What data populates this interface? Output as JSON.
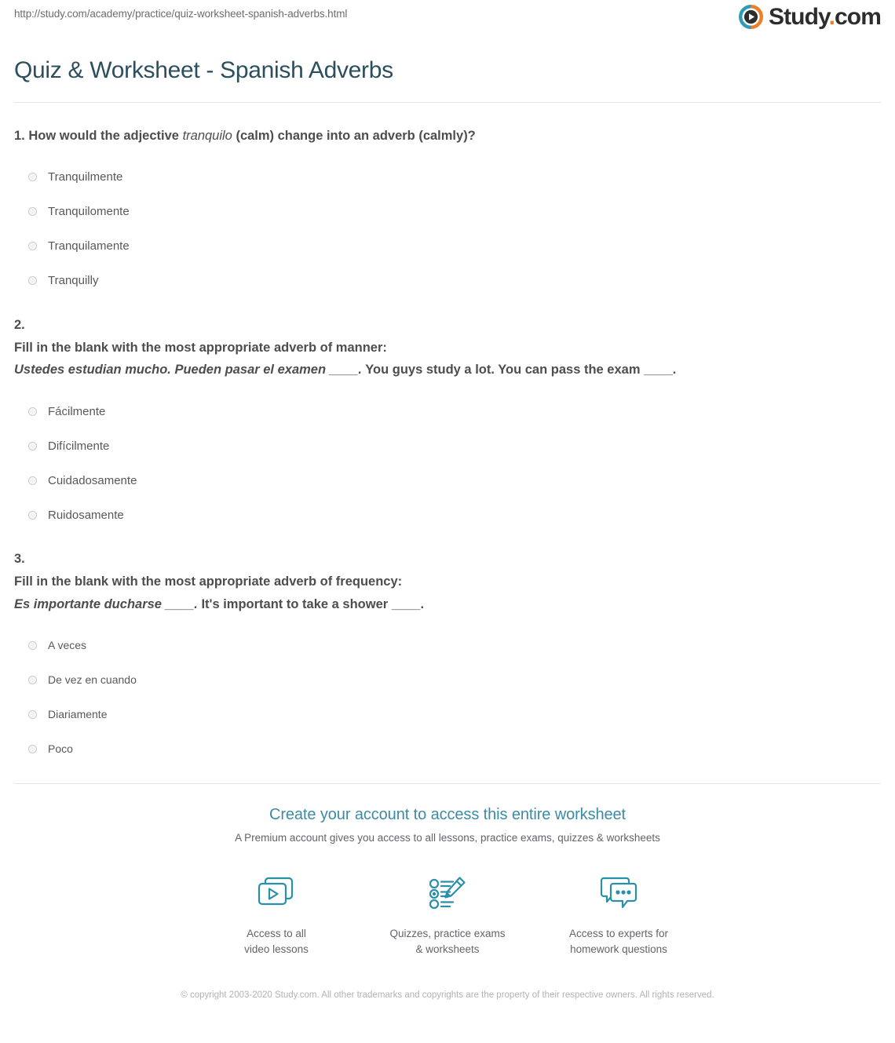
{
  "header": {
    "url": "http://study.com/academy/practice/quiz-worksheet-spanish-adverbs.html",
    "logo_text_main": "Study",
    "logo_text_dot": ".",
    "logo_text_tld": "com",
    "logo_icon": "play-circle-icon",
    "colors": {
      "logo_teal": "#2f9bb5",
      "logo_orange": "#f07e26",
      "title": "#2c4f5e",
      "link": "#3d8ba3",
      "icon_teal": "#2a8fa8"
    }
  },
  "title": "Quiz & Worksheet - Spanish Adverbs",
  "questions": [
    {
      "number": "1.",
      "inline": true,
      "prompt_before": "How would the adjective ",
      "prompt_italic": "tranquilo",
      "prompt_after": " (calm) change into an adverb (calmly)?",
      "options": [
        "Tranquilmente",
        "Tranquilomente",
        "Tranquilamente",
        "Tranquilly"
      ]
    },
    {
      "number": "2.",
      "inline": false,
      "prompt": "Fill in the blank with the most appropriate adverb of manner:",
      "sentence_italic": "Ustedes estudian mucho. Pueden pasar el examen ____.",
      "sentence_bold": " You guys study a lot. You can pass the exam ____.",
      "options": [
        "Fácilmente",
        "Difícilmente",
        "Cuidadosamente",
        "Ruidosamente"
      ]
    },
    {
      "number": "3.",
      "inline": false,
      "prompt": "Fill in the blank with the most appropriate adverb of frequency:",
      "sentence_italic": "Es importante ducharse ____.",
      "sentence_bold": " It's important to take a shower ____.",
      "options": [
        "A veces",
        "De vez en cuando",
        "Diariamente",
        "Poco"
      ]
    }
  ],
  "cta": {
    "link": "Create your account to access this entire worksheet",
    "subtitle": "A Premium account gives you access to all lessons, practice exams, quizzes & worksheets",
    "features": [
      {
        "icon": "video-stack-icon",
        "line1": "Access to all",
        "line2": "video lessons"
      },
      {
        "icon": "quiz-pencil-icon",
        "line1": "Quizzes, practice exams",
        "line2": "& worksheets"
      },
      {
        "icon": "chat-bubbles-icon",
        "line1": "Access to experts for",
        "line2": "homework questions"
      }
    ]
  },
  "footer": {
    "copyright": "© copyright 2003-2020 Study.com. All other trademarks and copyrights are the property of their respective owners. All rights reserved."
  }
}
